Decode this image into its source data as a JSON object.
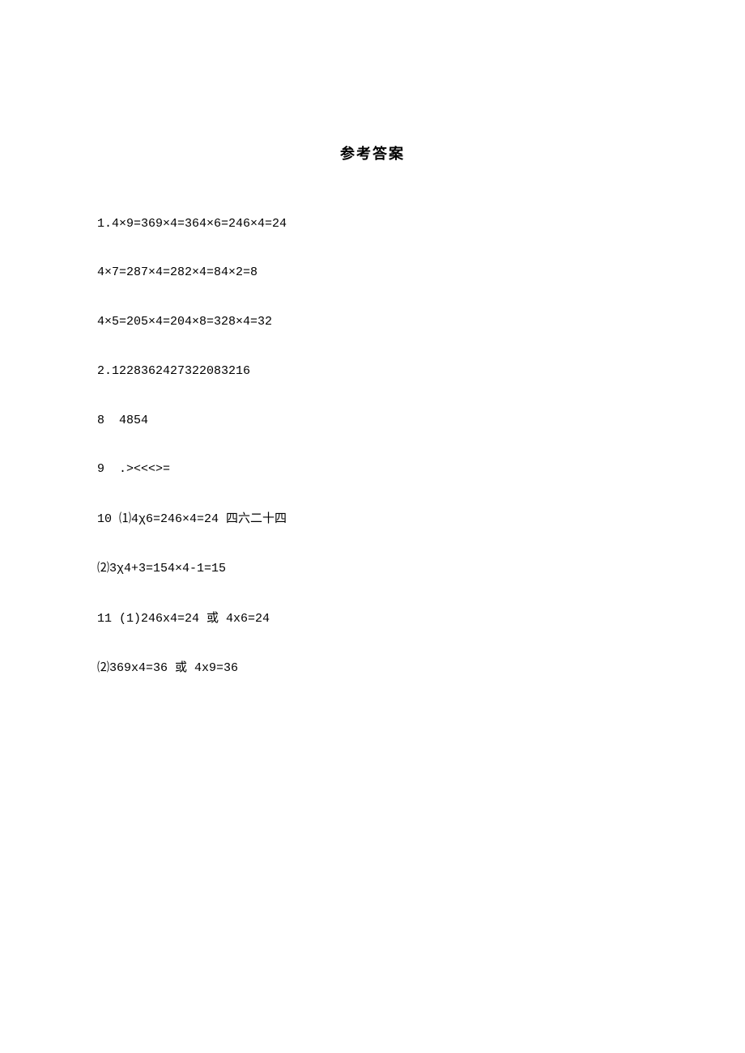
{
  "title": "参考答案",
  "lines": {
    "l1": "1.4×9=369×4=364×6=246×4=24",
    "l2": "4×7=287×4=282×4=84×2=8",
    "l3": "4×5=205×4=204×8=328×4=32",
    "l4": "2.1228362427322083216",
    "l5": "8  4854",
    "l6": "9  .><<<>=",
    "l7a": "10 ⑴4χ6=246×4=24 ",
    "l7b": "四六二十四",
    "l8": "⑵3χ4+3=154×4-1=15",
    "l9a": "11 (1)246x4=24 ",
    "l9b": "或",
    "l9c": " 4x6=24",
    "l10a": "⑵369x4=36 ",
    "l10b": "或",
    "l10c": " 4x9=36"
  }
}
